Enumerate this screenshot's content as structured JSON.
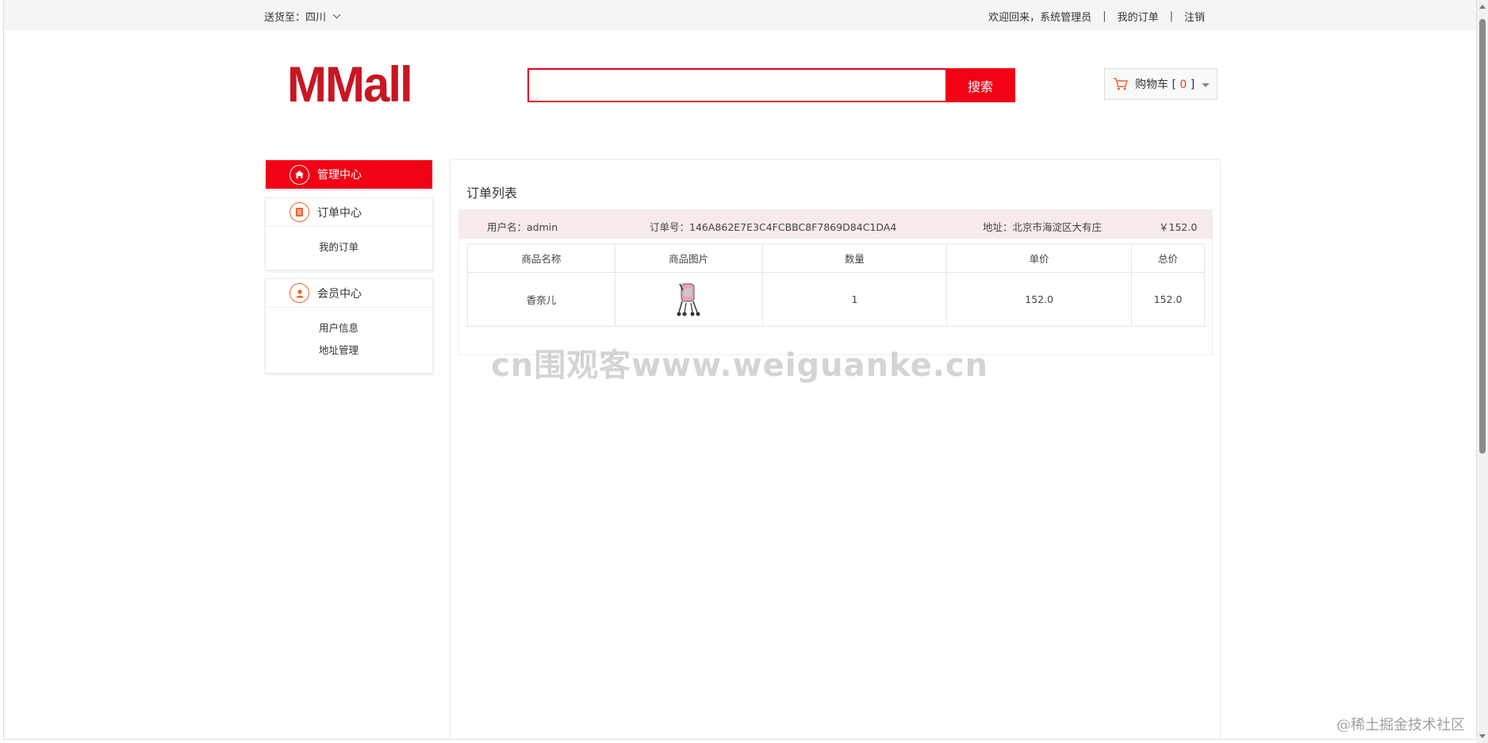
{
  "topbar": {
    "ship_label": "送货至：四川",
    "welcome": "欢迎回来，系统管理员",
    "my_orders": "我的订单",
    "logout": "注销",
    "separator": "|"
  },
  "header": {
    "logo": "MMall",
    "search_placeholder": "",
    "search_button": "搜索",
    "cart_label": "购物车 [",
    "cart_count": "0",
    "cart_close": "]"
  },
  "sidebar": {
    "admin_center": "管理中心",
    "order_center": "订单中心",
    "order_items": [
      "我的订单"
    ],
    "member_center": "会员中心",
    "member_items": [
      "用户信息",
      "地址管理"
    ]
  },
  "main": {
    "title": "订单列表",
    "order": {
      "username": "用户名：admin",
      "order_no": "订单号：146A862E7E3C4FCBBC8F7869D84C1DA4",
      "address": "地址：北京市海淀区大有庄",
      "total": "￥152.0"
    },
    "table": {
      "headers": [
        "商品名称",
        "商品图片",
        "数量",
        "单价",
        "总价"
      ],
      "rows": [
        {
          "name": "香奈儿",
          "image": "stroller-image",
          "qty": "1",
          "unit_price": "152.0",
          "total": "152.0"
        }
      ]
    }
  },
  "watermark": "cn围观客www.weiguanke.cn",
  "corner_watermark": "@稀土掘金技术社区",
  "colors": {
    "brand_red": "#f10215",
    "logo_red": "#c81623",
    "order_header_bg": "#f6ebe8",
    "icon_orange": "#f0642d"
  }
}
